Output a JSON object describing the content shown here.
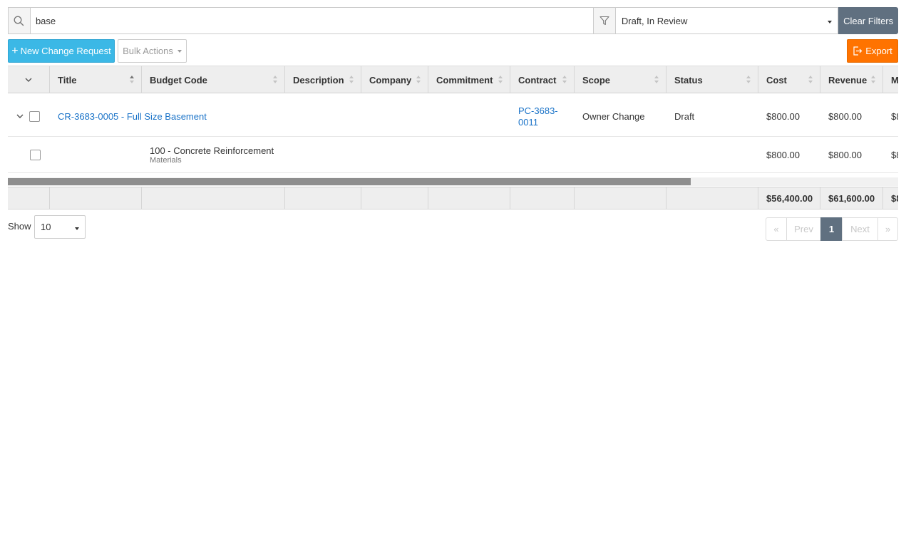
{
  "search": {
    "value": "base",
    "icon": "search-icon"
  },
  "filter": {
    "icon": "filter-icon",
    "selected": "Draft, In Review",
    "clear_label": "Clear Filters"
  },
  "toolbar": {
    "new_label": "New Change Request",
    "bulk_label": "Bulk Actions",
    "export_label": "Export"
  },
  "table": {
    "columns": [
      "Title",
      "Budget Code",
      "Description",
      "Company",
      "Commitment",
      "Contract",
      "Scope",
      "Status",
      "Cost",
      "Revenue",
      "M"
    ],
    "rows": [
      {
        "title": "CR-3683-0005 - Full Size Basement",
        "contract": "PC-3683-0011",
        "scope": "Owner Change",
        "status": "Draft",
        "cost": "$800.00",
        "revenue": "$800.00",
        "extra": "$8"
      },
      {
        "budget_code": "100 - Concrete Reinforcement",
        "budget_sub": "Materials",
        "cost": "$800.00",
        "revenue": "$800.00",
        "extra": "$8"
      }
    ],
    "totals": {
      "cost": "$56,400.00",
      "revenue": "$61,600.00",
      "extra": "$8"
    }
  },
  "paging": {
    "show_label": "Show",
    "page_size": "10",
    "first": "«",
    "prev": "Prev",
    "current": "1",
    "next": "Next",
    "last": "»"
  },
  "colors": {
    "primary": "#3bb8e6",
    "export": "#ff7300",
    "slate": "#607080",
    "link": "#1a73c8"
  }
}
